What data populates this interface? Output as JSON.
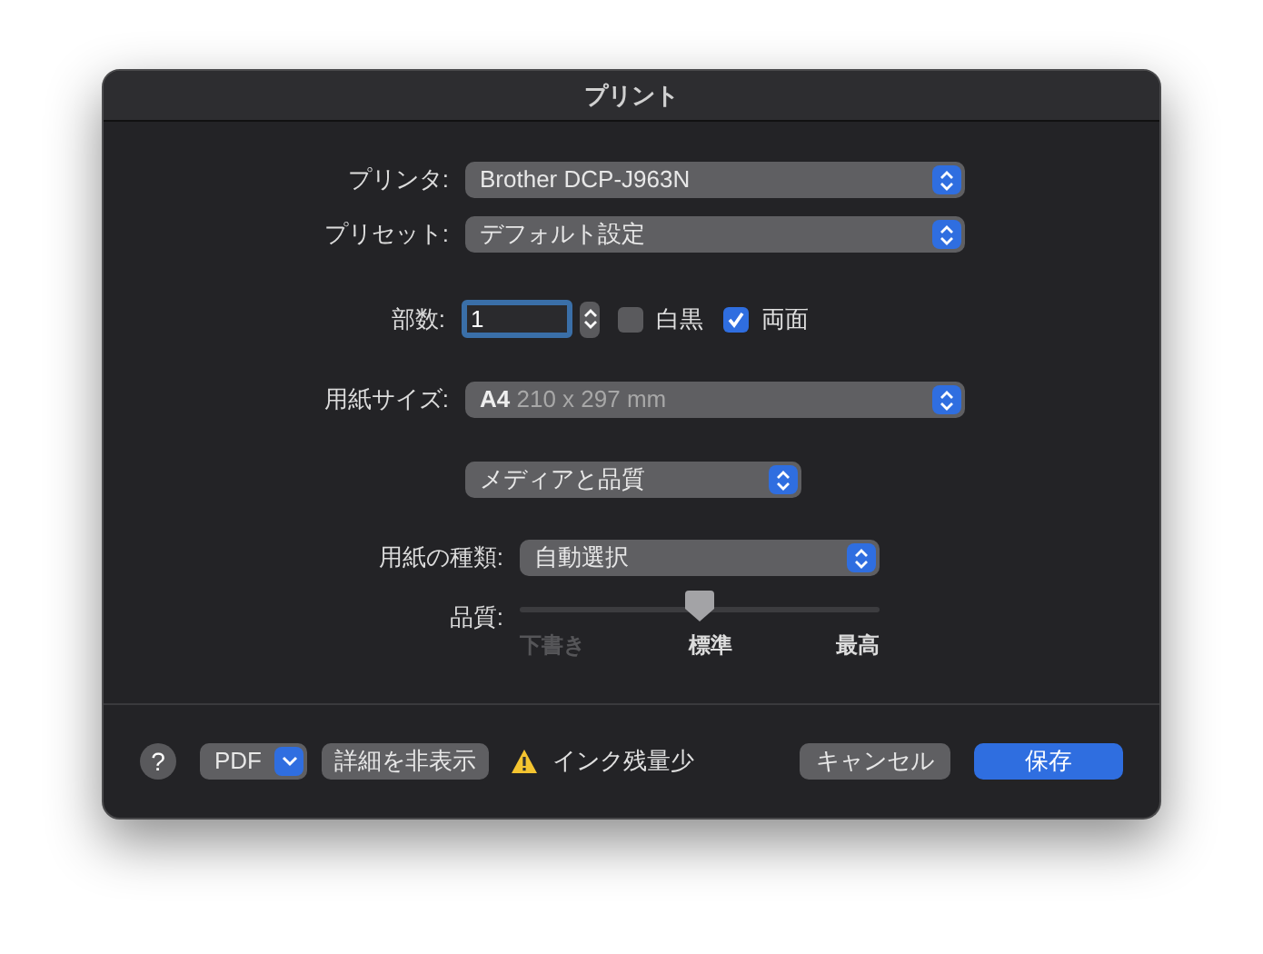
{
  "window": {
    "title": "プリント"
  },
  "printer": {
    "label": "プリンタ:",
    "value": "Brother DCP-J963N"
  },
  "preset": {
    "label": "プリセット:",
    "value": "デフォルト設定"
  },
  "copies": {
    "label": "部数:",
    "value": "1",
    "options": [
      {
        "label": "白黒",
        "checked": false
      },
      {
        "label": "両面",
        "checked": true
      }
    ]
  },
  "paper_size": {
    "label": "用紙サイズ:",
    "value": "A4",
    "detail": "210 x 297 mm"
  },
  "panel": {
    "value": "メディアと品質"
  },
  "paper_type": {
    "label": "用紙の種類:",
    "value": "自動選択"
  },
  "quality": {
    "label": "品質:",
    "level": 0.5,
    "ticks": [
      {
        "label": "下書き",
        "disabled": true
      },
      {
        "label": "標準",
        "disabled": false
      },
      {
        "label": "最高",
        "disabled": false
      }
    ]
  },
  "footer": {
    "help": "?",
    "pdf": "PDF",
    "details_button": "詳細を非表示",
    "warning": "インク残量少",
    "cancel": "キャンセル",
    "save": "保存"
  }
}
